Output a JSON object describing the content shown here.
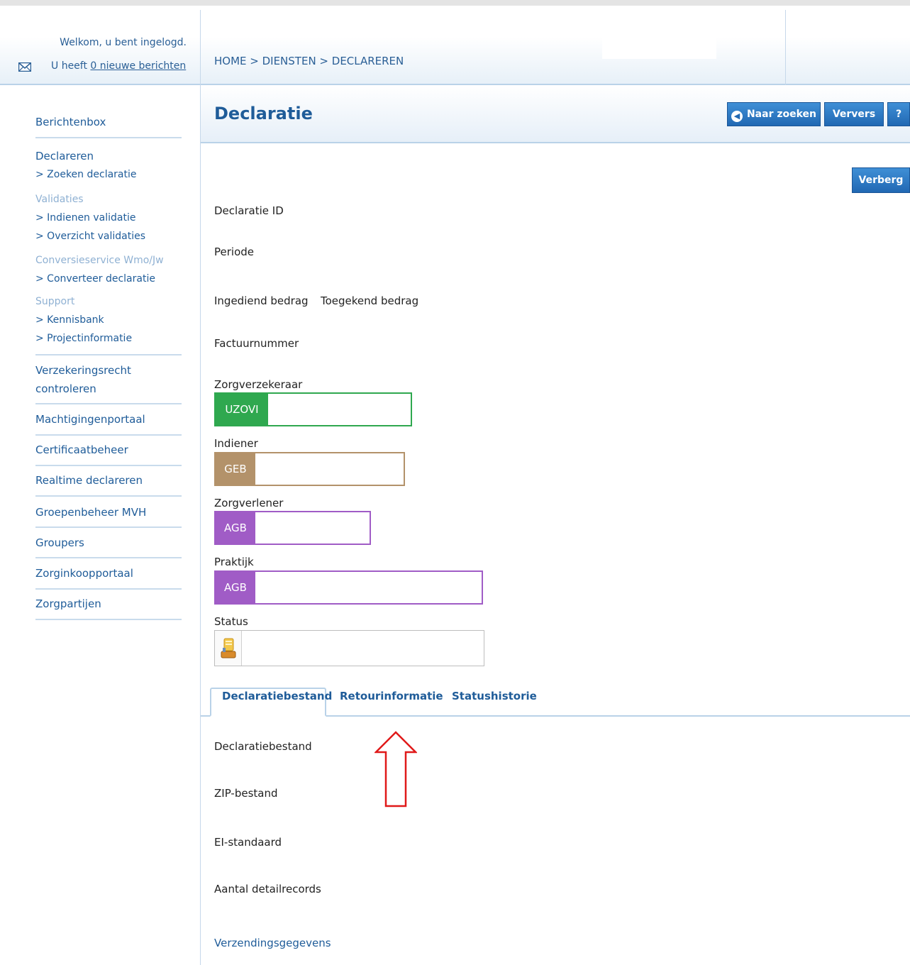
{
  "header": {
    "welcome": "Welkom, u bent ingelogd.",
    "messages_prefix": "U heeft ",
    "messages_link": "0 nieuwe berichten",
    "breadcrumb": "HOME > DIENSTEN > DECLAREREN"
  },
  "sidebar": {
    "berichtenbox": "Berichtenbox",
    "declareren": "Declareren",
    "zoeken_declaratie": "> Zoeken declaratie",
    "validaties": "Validaties",
    "indienen_validatie": "> Indienen validatie",
    "overzicht_validaties": "> Overzicht validaties",
    "conversieservice": "Conversieservice Wmo/Jw",
    "converteer_declaratie": "> Converteer declaratie",
    "support": "Support",
    "kennisbank": "> Kennisbank",
    "projectinformatie": "> Projectinformatie",
    "verzekeringsrecht_1": "Verzekeringsrecht",
    "verzekeringsrecht_2": "controleren",
    "machtigingenportaal": "Machtigingenportaal",
    "certificaatbeheer": "Certificaatbeheer",
    "realtime_declareren": "Realtime declareren",
    "groepenbeheer": "Groepenbeheer MVH",
    "groupers": "Groupers",
    "zorginkoopportaal": "Zorginkoopportaal",
    "zorgpartijen": "Zorgpartijen"
  },
  "main": {
    "title": "Declaratie",
    "buttons": {
      "naar_zoeken": "Naar zoeken",
      "ververs": "Ververs",
      "help": "?",
      "verberg": "Verberg"
    },
    "fields": {
      "declaratie_id": "Declaratie ID",
      "periode": "Periode",
      "ingediend_bedrag": "Ingediend bedrag",
      "toegekend_bedrag": "Toegekend bedrag",
      "factuurnummer": "Factuurnummer",
      "zorgverzekeraar": "Zorgverzekeraar",
      "indiener": "Indiener",
      "zorgverlener": "Zorgverlener",
      "praktijk": "Praktijk",
      "status": "Status"
    },
    "tags": {
      "uzovi": "UZOVI",
      "geb": "GEB",
      "agb_zorgverlener": "AGB",
      "agb_praktijk": "AGB"
    },
    "tabs": [
      "Declaratiebestand",
      "Retourinformatie",
      "Statushistorie"
    ],
    "tab_fields": {
      "declaratiebestand": "Declaratiebestand",
      "zip": "ZIP-bestand",
      "ei_standaard": "EI-standaard",
      "aantal": "Aantal detailrecords",
      "verzending": "Verzendingsgegevens"
    }
  },
  "colors": {
    "uzovi": "#2fa84f",
    "geb": "#b3926a",
    "agb": "#a05cc6",
    "link": "#1f5c99",
    "arrow": "#e01919"
  }
}
